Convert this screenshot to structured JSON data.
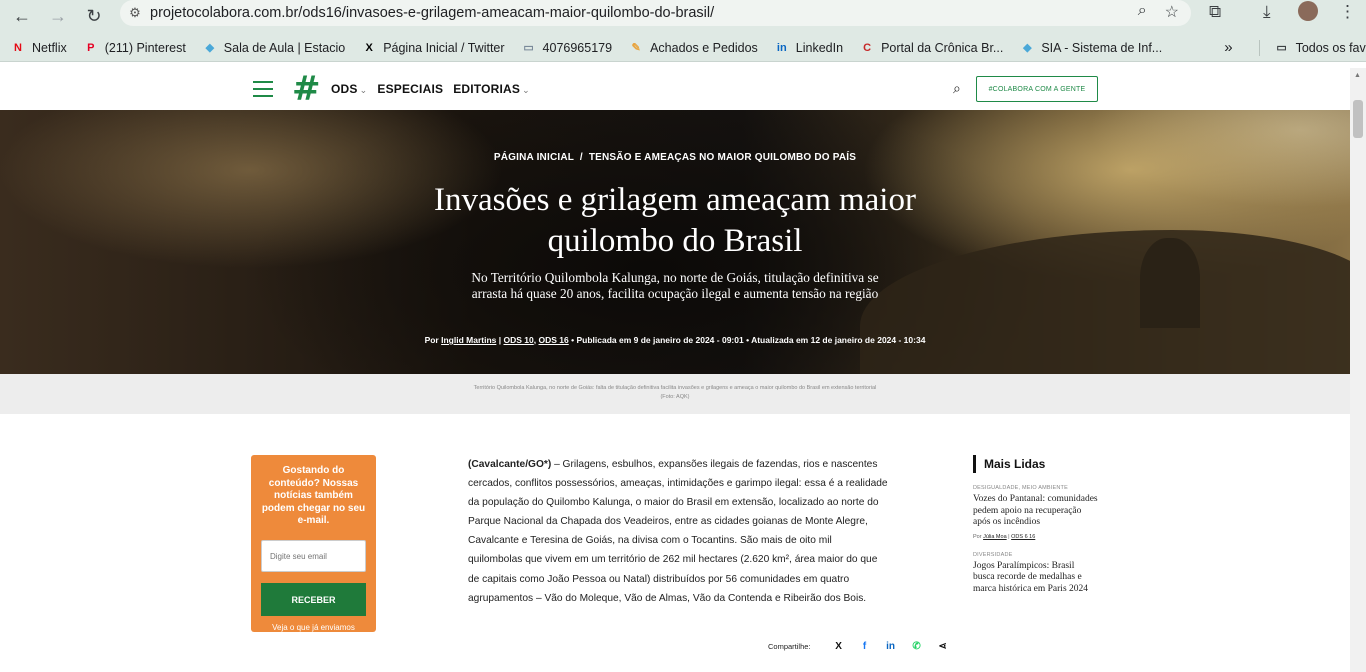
{
  "browser": {
    "url": "projetocolabora.com.br/ods16/invasoes-e-grilagem-ameacam-maior-quilombo-do-brasil/",
    "bookmarks": [
      {
        "label": "Netflix",
        "icon": "netflix-icon",
        "icon_char": "N",
        "color": "#e50914"
      },
      {
        "label": "(211) Pinterest",
        "icon": "pinterest-icon",
        "icon_char": "P",
        "color": "#e60023"
      },
      {
        "label": "Sala de Aula | Estacio",
        "icon": "diamond-icon",
        "icon_char": "◆",
        "color": "#4aa8d8"
      },
      {
        "label": "Página Inicial / Twitter",
        "icon": "x-icon",
        "icon_char": "X",
        "color": "#000000"
      },
      {
        "label": "4076965179",
        "icon": "card-icon",
        "icon_char": "▭",
        "color": "#7a8a99"
      },
      {
        "label": "Achados e Pedidos",
        "icon": "tag-icon",
        "icon_char": "✎",
        "color": "#e8a33d"
      },
      {
        "label": "LinkedIn",
        "icon": "linkedin-icon",
        "icon_char": "in",
        "color": "#0a66c2"
      },
      {
        "label": "Portal da Crônica Br...",
        "icon": "c-icon",
        "icon_char": "C",
        "color": "#c62828"
      },
      {
        "label": "SIA - Sistema de Inf...",
        "icon": "diamond-icon",
        "icon_char": "◆",
        "color": "#4aa8d8"
      }
    ],
    "more": "»",
    "all_favorites": "Todos os favoritos"
  },
  "header": {
    "menu": [
      {
        "label": "ODS",
        "has_caret": true
      },
      {
        "label": "ESPECIAIS",
        "has_caret": false
      },
      {
        "label": "EDITORIAS",
        "has_caret": true
      }
    ],
    "cta": "#COLABORA COM A GENTE",
    "brand_color": "#1f8a47"
  },
  "hero": {
    "breadcrumb_home": "PÁGINA INICIAL",
    "breadcrumb_sep": "/",
    "breadcrumb_current": "TENSÃO E AMEAÇAS NO MAIOR QUILOMBO DO PAÍS",
    "title": "Invasões e grilagem ameaçam maior quilombo do Brasil",
    "subtitle": "No Território Quilombola Kalunga, no norte de Goiás, titulação definitiva se arrasta há quase 20 anos, facilita ocupação ilegal e aumenta tensão na região",
    "byline": {
      "prefix": "Por",
      "author": "Inglid Martins",
      "sep1": "|",
      "ods1": "ODS 10",
      "comma": ",",
      "ods2": "ODS 16",
      "published": "• Publicada em 9 de janeiro de 2024 - 09:01 • Atualizada em 12 de janeiro de 2024 - 10:34"
    },
    "caption": "Território Quilombola Kalunga, no norte de Goiás: falta de titulação definitiva facilita invasões e grilagens e ameaça o maior quilombo do Brasil em extensão territorial (Foto: AQK)"
  },
  "newsletter": {
    "text": "Gostando do conteúdo? Nossas notícias também podem chegar no seu e-mail.",
    "placeholder": "Digite seu email",
    "button": "RECEBER",
    "link": "Veja o que já enviamos",
    "color": "#ee8a3b"
  },
  "article": {
    "location": "(Cavalcante/GO*)",
    "body": " – Grilagens, esbulhos, expansões ilegais de fazendas, rios e nascentes cercados, conflitos possessórios, ameaças, intimidações e garimpo ilegal: essa é a realidade da população do Quilombo Kalunga, o maior do Brasil em extensão, localizado ao norte do Parque Nacional da Chapada dos Veadeiros, entre as cidades goianas de Monte Alegre, Cavalcante e Teresina de Goiás, na divisa com o Tocantins. São mais de oito mil quilombolas que vivem em um território de 262 mil hectares (2.620 km², área maior do que de capitais como João Pessoa ou Natal) distribuídos por 56 comunidades em quatro agrupamentos – Vão do Moleque, Vão de Almas, Vão da Contenda e Ribeirão dos Bois."
  },
  "share": {
    "label": "Compartilhe:",
    "icons": [
      {
        "name": "x-share-icon",
        "char": "X",
        "color": "#111111"
      },
      {
        "name": "facebook-share-icon",
        "char": "f",
        "color": "#1877f2"
      },
      {
        "name": "linkedin-share-icon",
        "char": "in",
        "color": "#0a66c2"
      },
      {
        "name": "whatsapp-share-icon",
        "char": "✆",
        "color": "#25d366"
      },
      {
        "name": "share-icon",
        "char": "⋖",
        "color": "#111111"
      }
    ]
  },
  "sidebar": {
    "title": "Mais Lidas",
    "items": [
      {
        "category": "DESIGUALDADE, MEIO AMBIENTE",
        "headline": "Vozes do Pantanal: comunidades pedem apoio na recuperação após os incêndios",
        "by_prefix": "Por",
        "author": "Júlia Moa",
        "sep": "|",
        "ods": "ODS 6 16"
      },
      {
        "category": "DIVERSIDADE",
        "headline": "Jogos Paralímpicos: Brasil busca recorde de medalhas e marca histórica em Paris 2024"
      }
    ]
  }
}
